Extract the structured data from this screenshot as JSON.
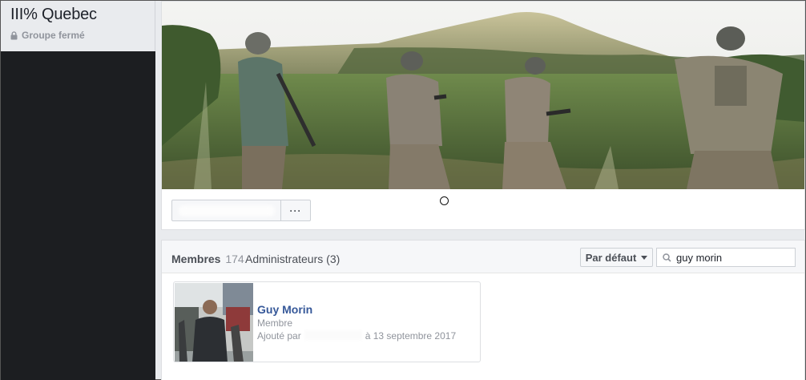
{
  "group": {
    "name": "III% Quebec",
    "type": "Groupe fermé"
  },
  "actions": {
    "more_label": "···"
  },
  "members": {
    "tab_label": "Membres",
    "count": "174",
    "admins_label": "Administrateurs",
    "admins_count": "(3)",
    "sort_label": "Par défaut",
    "search_value": "guy morin",
    "results": [
      {
        "name": "Guy Morin",
        "role": "Membre",
        "added_prefix": "Ajouté par",
        "added_date": "à 13 septembre 2017"
      }
    ]
  },
  "colors": {
    "link": "#365899",
    "sidebar_dark": "#1c1e21",
    "page_bg": "#e9ebee"
  },
  "icons": [
    "lock-icon",
    "search-icon",
    "caret-down-icon",
    "more-icon"
  ]
}
